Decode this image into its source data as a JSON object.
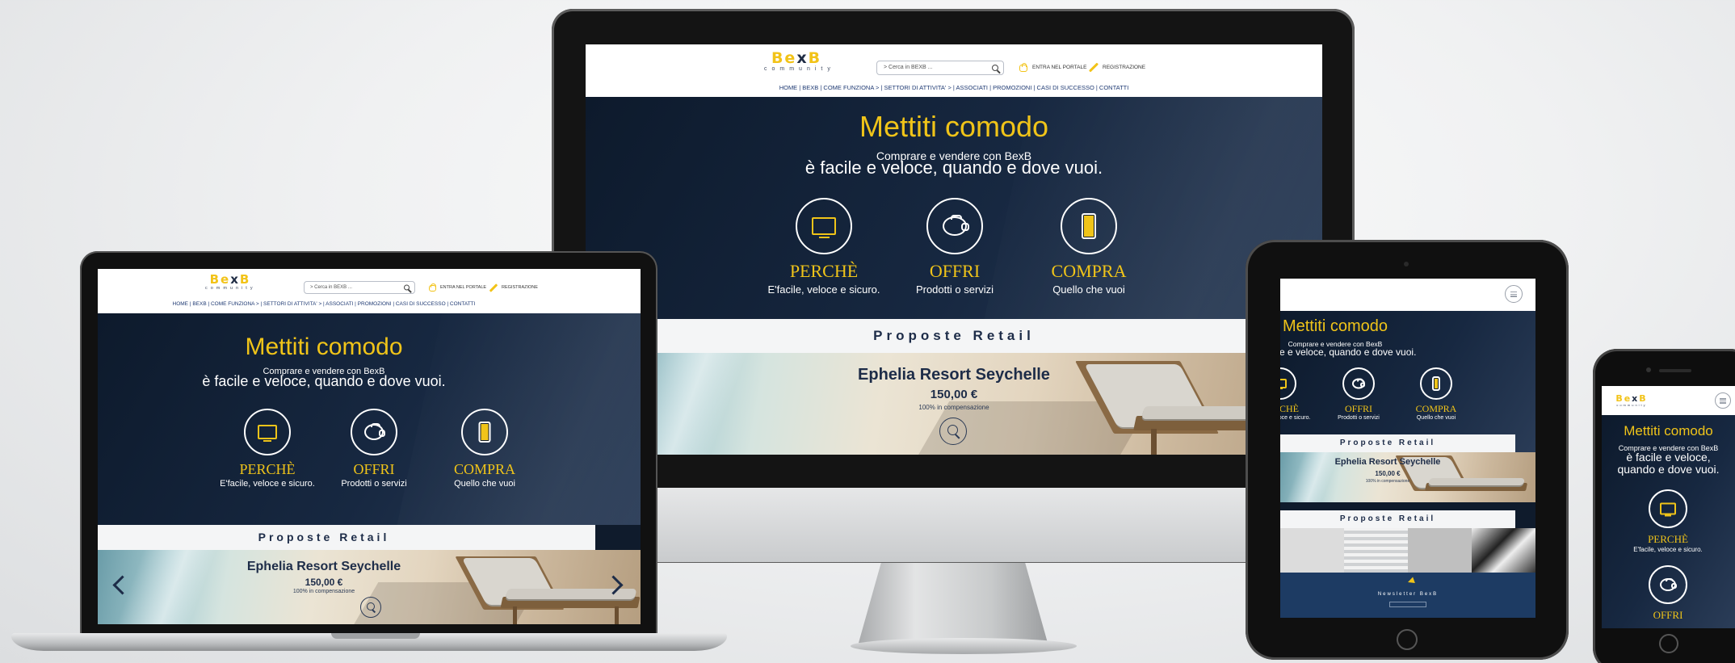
{
  "site": {
    "logo_word_a": "Be",
    "logo_word_x": "x",
    "logo_word_b": "B",
    "logo_sub": "community",
    "search_placeholder": "> Cerca in BEXB ...",
    "login_link": "ENTRA NEL PORTALE",
    "register_link": "REGISTRAZIONE",
    "nav": "HOME  |  BEXB  |  COME FUNZIONA  >  |  SETTORI  DI ATTIVITA'  >  |  ASSOCIATI  |  PROMOZIONI  |  CASI DI SUCCESSO  |  CONTATTI",
    "hero_title": "Mettiti comodo",
    "hero_line1": "Comprare e vendere con BexB",
    "hero_line2": "è facile e veloce, quando e dove vuoi.",
    "features": [
      {
        "title": "PERCHÈ",
        "subtitle": "E'facile, veloce e sicuro.",
        "icon": "monitor-icon"
      },
      {
        "title": "OFFRI",
        "subtitle": "Prodotti o servizi",
        "icon": "piggy-bank-icon"
      },
      {
        "title": "COMPRA",
        "subtitle": "Quello che vuoi",
        "icon": "smartphone-icon"
      }
    ],
    "retail_heading": "Proposte Retail",
    "promo_title": "Ephelia Resort Seychelle",
    "promo_price": "150,00 €",
    "promo_comp": "100% in compensazione",
    "newsletter_title": "Newsletter BexB"
  },
  "colors": {
    "accent_yellow": "#f0c419",
    "navy": "#0f1b2c",
    "nav_blue": "#1f3a73"
  }
}
